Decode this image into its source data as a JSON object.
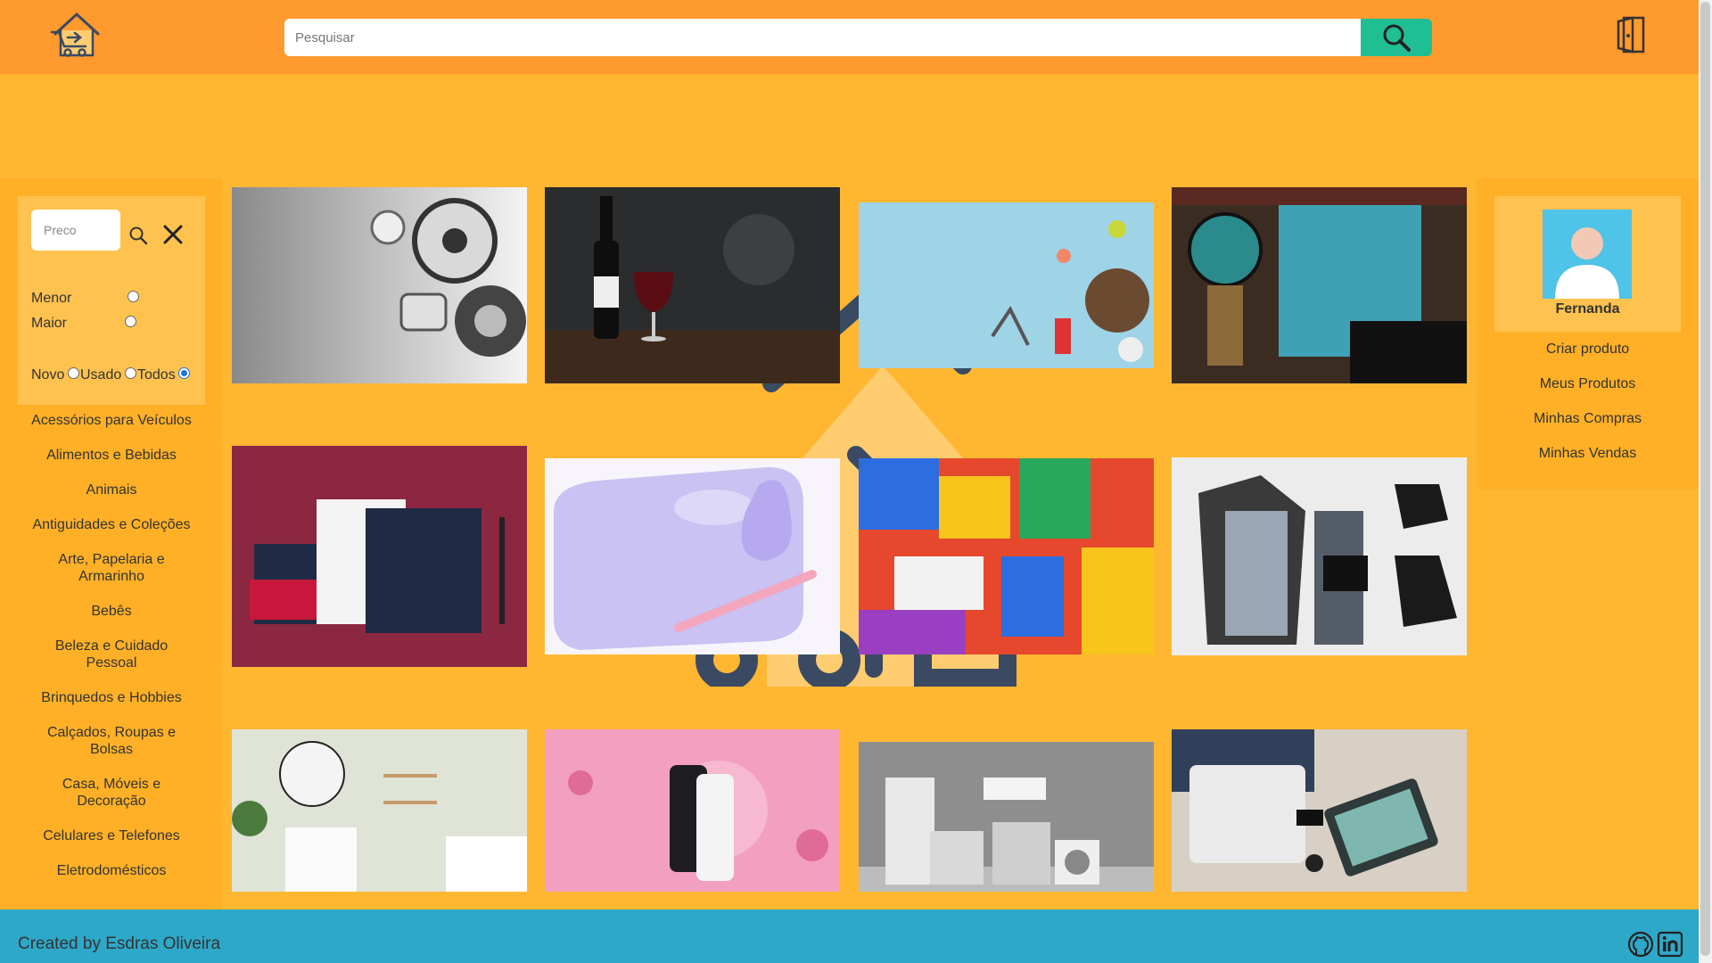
{
  "header": {
    "logo_icon": "shopping-cart-house-icon",
    "search_placeholder": "Pesquisar",
    "search_icon": "search-icon",
    "exit_icon": "exit-door-icon",
    "colors": {
      "header_bg": "#ff9a2e",
      "page_bg": "#ffb732",
      "search_button": "#1fbf93",
      "footer_bg": "#2ea8c8"
    }
  },
  "filters": {
    "price_placeholder": "Preco",
    "sort": [
      {
        "label": "Menor",
        "checked": false
      },
      {
        "label": "Maior",
        "checked": false
      }
    ],
    "condition": [
      {
        "label": "Novo",
        "checked": false
      },
      {
        "label": "Usado",
        "checked": false
      },
      {
        "label": "Todos",
        "checked": true
      }
    ]
  },
  "categories": [
    "Acessórios para Veículos",
    "Alimentos e Bebidas",
    "Animais",
    "Antiguidades e Coleções",
    "Arte, Papelaria e Armarinho",
    "Bebês",
    "Beleza e Cuidado Pessoal",
    "Brinquedos e Hobbies",
    "Calçados, Roupas e Bolsas",
    "Casa, Móveis e Decoração",
    "Celulares e Telefones",
    "Eletrodomésticos"
  ],
  "profile": {
    "name": "Fernanda",
    "menu": [
      "Criar produto",
      "Meus Produtos",
      "Minhas Compras",
      "Minhas Vendas"
    ]
  },
  "products": [
    "auto-parts-image",
    "wine-image",
    "pet-supplies-image",
    "vinyl-records-image",
    "stationery-mockup-image",
    "baby-care-image",
    "building-blocks-image",
    "clothing-flatlay-image",
    "bathroom-decor-image",
    "smartphones-image",
    "home-appliances-image",
    "travel-gadgets-image"
  ],
  "footer": {
    "credit": "Created by Esdras Oliveira",
    "github_icon": "github-icon",
    "linkedin_icon": "linkedin-icon"
  }
}
